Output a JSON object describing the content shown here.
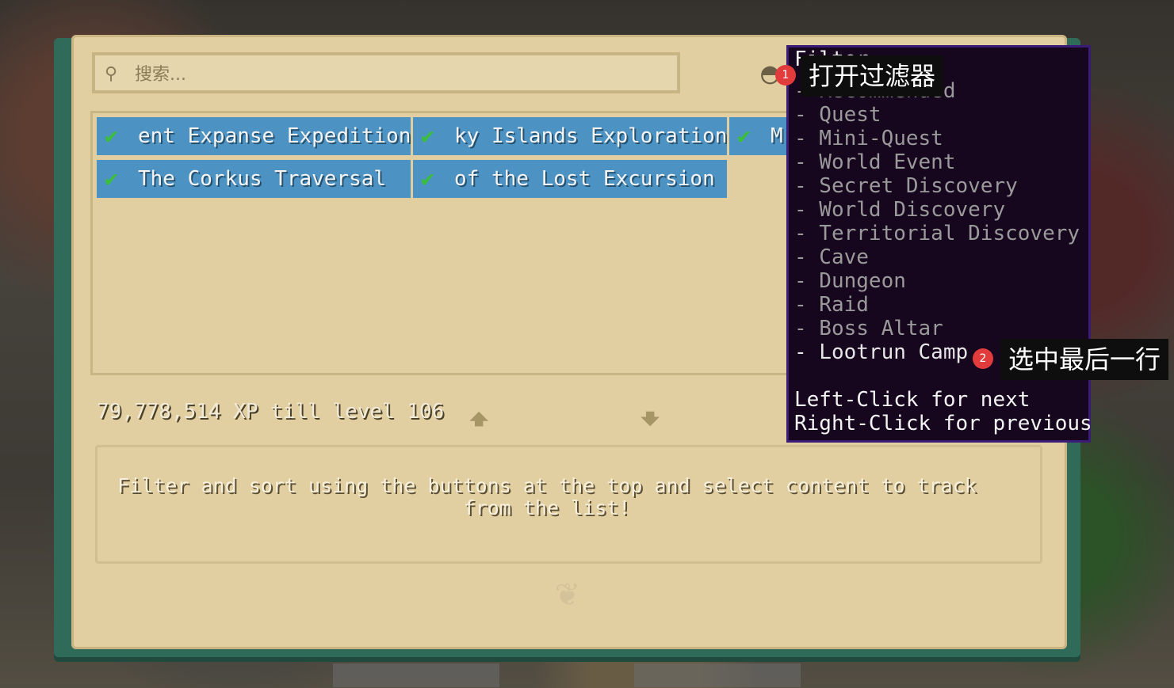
{
  "search": {
    "placeholder": "搜索..."
  },
  "content_list": [
    {
      "label": "ent Expanse Expedition",
      "checked": true
    },
    {
      "label": "ky Islands Exploration",
      "checked": true
    },
    {
      "label": "M",
      "checked": true
    },
    {
      "label": "The Corkus Traversal",
      "checked": true
    },
    {
      "label": "of the Lost Excursion",
      "checked": true
    }
  ],
  "xp_text": "79,778,514 XP till level 106",
  "hint_text": "Filter and sort using the buttons at the top and select content to track from the list!",
  "filter_tooltip": {
    "title": "Filter",
    "items": [
      "- Recommended",
      "- Quest",
      "- Mini-Quest",
      "- World Event",
      "- Secret Discovery",
      "- World Discovery",
      "- Territorial Discovery",
      "- Cave",
      "- Dungeon",
      "- Raid",
      "- Boss Altar",
      "- Lootrun Camp"
    ],
    "selected_index": 11,
    "hint_left": "Left-Click for next",
    "hint_right": "Right-Click for previous"
  },
  "annotations": [
    {
      "badge": "1",
      "text": "打开过滤器"
    },
    {
      "badge": "2",
      "text": "选中最后一行"
    }
  ],
  "icons": {
    "search": "magnifier-icon",
    "check": "check-icon",
    "up": "arrow-up-icon",
    "down": "arrow-down-icon"
  },
  "colors": {
    "card": "#4c93c4",
    "check": "#3bbf3b",
    "parchment": "#e2cfa1",
    "tooltip_bg": "#16061e",
    "tooltip_border": "#3b1b78"
  }
}
